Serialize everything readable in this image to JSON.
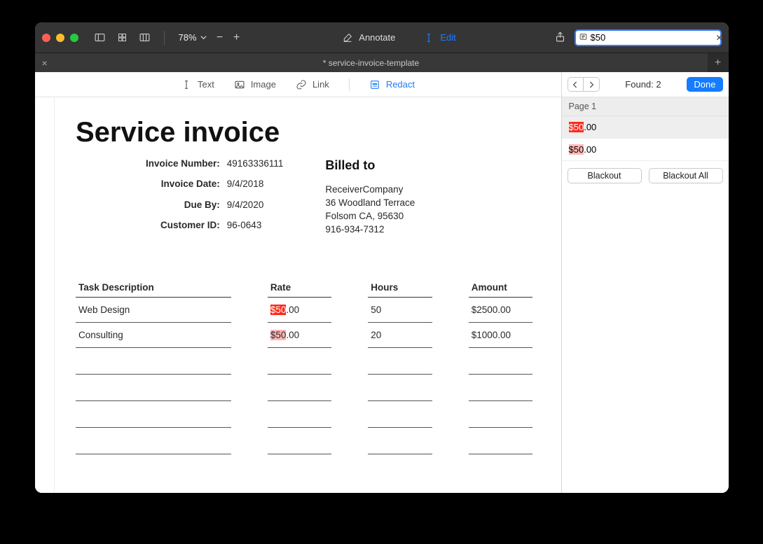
{
  "window": {
    "zoom": "78%",
    "annotate_label": "Annotate",
    "edit_label": "Edit",
    "search_value": "$50",
    "tab_title": "* service-invoice-template"
  },
  "doc_toolbar": {
    "text": "Text",
    "image": "Image",
    "link": "Link",
    "redact": "Redact"
  },
  "side": {
    "found_label": "Found: 2",
    "done_label": "Done",
    "page_header": "Page 1",
    "results": [
      {
        "match": "$50",
        "suffix": ".00",
        "highlight": "red",
        "selected": true
      },
      {
        "match": "$50",
        "suffix": ".00",
        "highlight": "pink",
        "selected": false
      }
    ],
    "blackout_label": "Blackout",
    "blackout_all_label": "Blackout All"
  },
  "invoice": {
    "title": "Service invoice",
    "meta_labels": {
      "number": "Invoice Number:",
      "date": "Invoice Date:",
      "due": "Due By:",
      "customer": "Customer ID:"
    },
    "meta_values": {
      "number": "49163336111",
      "date": "9/4/2018",
      "due": "9/4/2020",
      "customer": "96-0643"
    },
    "billed_heading": "Billed to",
    "billed_to": {
      "company": "ReceiverCompany",
      "addr1": "36 Woodland Terrace",
      "addr2": "Folsom CA, 95630",
      "phone": "916-934-7312"
    },
    "table": {
      "headers": {
        "desc": "Task Description",
        "rate": "Rate",
        "hours": "Hours",
        "amount": "Amount"
      },
      "rows": [
        {
          "desc": "Web Design",
          "rate_match": "$50",
          "rate_suffix": ".00",
          "rate_hl": "red",
          "hours": "50",
          "amount": "$2500.00"
        },
        {
          "desc": "Consulting",
          "rate_match": "$50",
          "rate_suffix": ".00",
          "rate_hl": "pink",
          "hours": "20",
          "amount": "$1000.00"
        }
      ],
      "empty_rows": 4
    }
  }
}
